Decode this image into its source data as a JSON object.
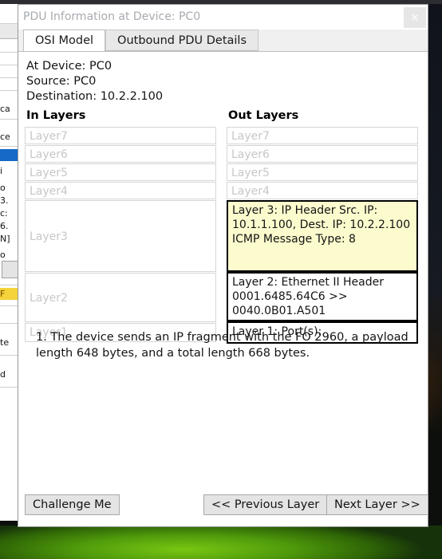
{
  "window": {
    "title": "PDU Information at Device: PC0",
    "close_icon": "×",
    "close_glyph_name": "close-icon"
  },
  "tabs": [
    {
      "label": "OSI Model",
      "active": true
    },
    {
      "label": "Outbound PDU Details",
      "active": false
    }
  ],
  "device_info": {
    "at_device": "At Device: PC0",
    "source": "Source: PC0",
    "destination": "Destination: 10.2.2.100"
  },
  "in_layers": {
    "title": "In Layers",
    "items": [
      {
        "label": "Layer7",
        "state": "disabled"
      },
      {
        "label": "Layer6",
        "state": "disabled"
      },
      {
        "label": "Layer5",
        "state": "disabled"
      },
      {
        "label": "Layer4",
        "state": "disabled"
      },
      {
        "label": "Layer3",
        "state": "disabled"
      },
      {
        "label": "Layer2",
        "state": "disabled"
      },
      {
        "label": "Layer1",
        "state": "disabled"
      }
    ]
  },
  "out_layers": {
    "title": "Out Layers",
    "items": [
      {
        "label": "Layer7",
        "state": "disabled"
      },
      {
        "label": "Layer6",
        "state": "disabled"
      },
      {
        "label": "Layer5",
        "state": "disabled"
      },
      {
        "label": "Layer4",
        "state": "disabled"
      },
      {
        "label": "Layer 3: IP Header Src. IP: 10.1.1.100, Dest. IP: 10.2.2.100 ICMP Message Type: 8",
        "state": "active-highlight"
      },
      {
        "label": "Layer 2: Ethernet II Header 0001.6485.64C6 >> 0040.0B01.A501",
        "state": "active"
      },
      {
        "label": "Layer 1: Port(s):",
        "state": "active"
      }
    ]
  },
  "description": "1. The device sends an IP fragment with the FO 2960, a payload length 648 bytes, and a total length 668 bytes.",
  "footer": {
    "challenge_label": "Challenge Me",
    "previous_label": "<< Previous Layer",
    "next_label": "Next Layer >>"
  },
  "colors": {
    "highlight_yellow": "#fcfbce",
    "active_border": "#000000",
    "disabled_text": "#c7c7c7",
    "title_text": "#a7abb0",
    "button_face": "#e4e4e4"
  }
}
